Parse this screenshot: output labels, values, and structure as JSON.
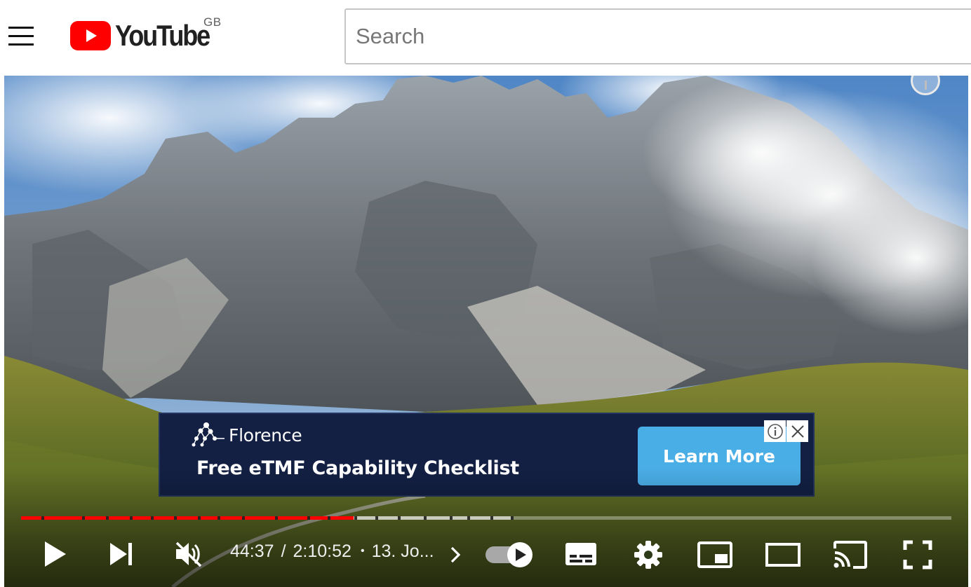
{
  "header": {
    "logo_text": "YouTube",
    "country_code": "GB",
    "search_placeholder": "Search"
  },
  "ad": {
    "brand": "Florence",
    "headline": "Free eTMF Capability Checklist",
    "cta_label": "Learn More",
    "button_color": "#4aaee6",
    "background_color": "#132043"
  },
  "player": {
    "current_time": "44:37",
    "separator": "/",
    "duration": "2:10:52",
    "chapter_dot": "•",
    "chapter_title": "13. Jo...",
    "progress_played_fraction": 0.3575,
    "progress_buffered_fraction": 0.5264,
    "autoplay_on": true,
    "accent_color": "#ff0000"
  }
}
